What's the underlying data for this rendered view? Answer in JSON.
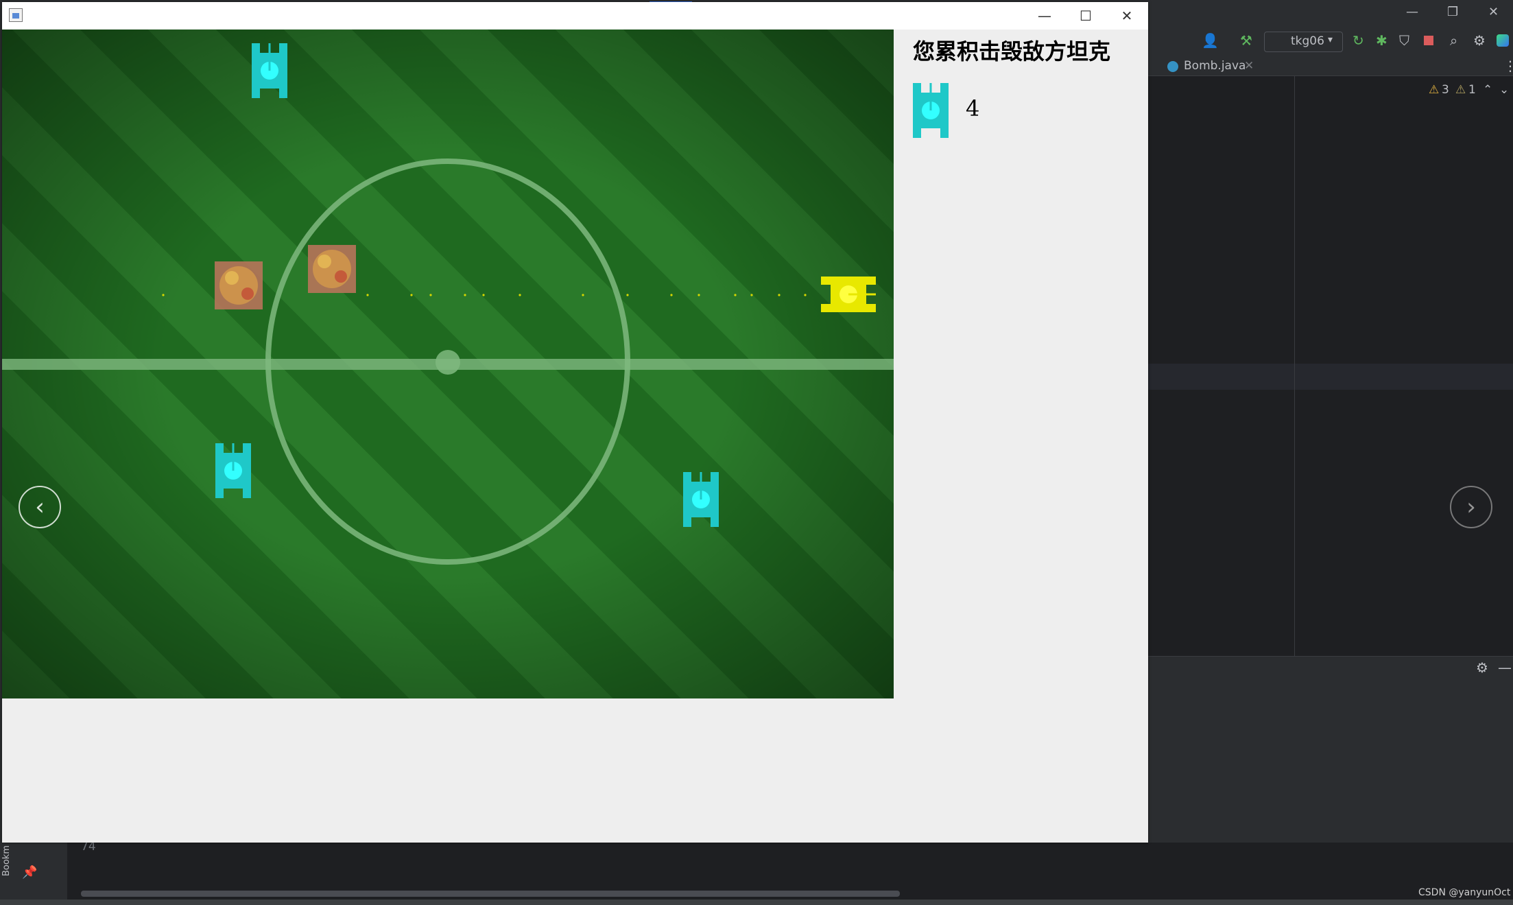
{
  "ide": {
    "tab_label": "Bomb.java",
    "run_config": "tkg06",
    "warnings_count": "3",
    "weak_warnings_count": "1",
    "line_number": "74",
    "bookmarks_label": "Bookm"
  },
  "game": {
    "score_title": "您累积击毁敌方坦克",
    "score_value": "4",
    "enemy_tank_color": "#1fc8c8",
    "player_tank_color": "#e8e800",
    "field_color": "#2a7a2a",
    "enemy_tanks": [
      {
        "direction": "up"
      },
      {
        "direction": "up"
      },
      {
        "direction": "up"
      }
    ],
    "player_tank": {
      "direction": "right"
    },
    "explosions": 2
  },
  "viewer": {
    "prev_icon": "chevron-left-icon",
    "next_icon": "chevron-right-icon"
  },
  "watermark": "CSDN @yanyunOct"
}
